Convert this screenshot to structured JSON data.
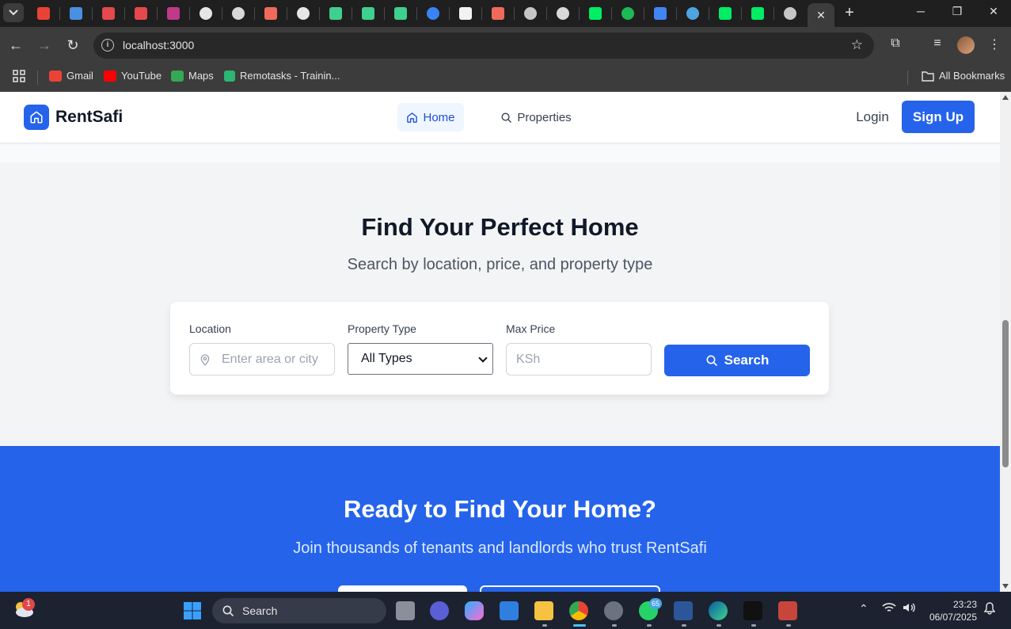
{
  "browser": {
    "url": "localhost:3000",
    "bookmarks": [
      {
        "label": "Gmail",
        "icon": "gmail-icon",
        "color": "#ea4335"
      },
      {
        "label": "YouTube",
        "icon": "youtube-icon",
        "color": "#ff0000"
      },
      {
        "label": "Maps",
        "icon": "maps-icon",
        "color": "#34a853"
      },
      {
        "label": "Remotasks - Trainin...",
        "icon": "remotasks-icon",
        "color": "#2bb673"
      }
    ],
    "all_bookmarks_label": "All Bookmarks",
    "tab_icons": [
      "gmail",
      "star",
      "red-arrow",
      "red-arrow",
      "pen",
      "github",
      "openai",
      "claude",
      "github",
      "bolt",
      "bolt",
      "bolt",
      "blue-circle",
      "triangle",
      "claude",
      "chrome",
      "tiger",
      "leaf",
      "spotify",
      "docs",
      "wave",
      "leaf",
      "leaf",
      "chrome"
    ]
  },
  "site": {
    "brand": "RentSafi",
    "nav": {
      "home": "Home",
      "properties": "Properties",
      "login": "Login",
      "signup": "Sign Up"
    },
    "hero": {
      "title": "Find Your Perfect Home",
      "subtitle": "Search by location, price, and property type"
    },
    "search": {
      "location_label": "Location",
      "location_placeholder": "Enter area or city",
      "type_label": "Property Type",
      "type_value": "All Types",
      "price_label": "Max Price",
      "price_placeholder": "KSh",
      "button": "Search"
    },
    "cta": {
      "title": "Ready to Find Your Home?",
      "subtitle": "Join thousands of tenants and landlords who trust RentSafi"
    },
    "colors": {
      "primary": "#2563eb",
      "hero_bg": "#f3f4f6"
    }
  },
  "taskbar": {
    "search_label": "Search",
    "weather_badge": "1",
    "whatsapp_badge": "65",
    "time": "23:23",
    "date": "06/07/2025"
  }
}
